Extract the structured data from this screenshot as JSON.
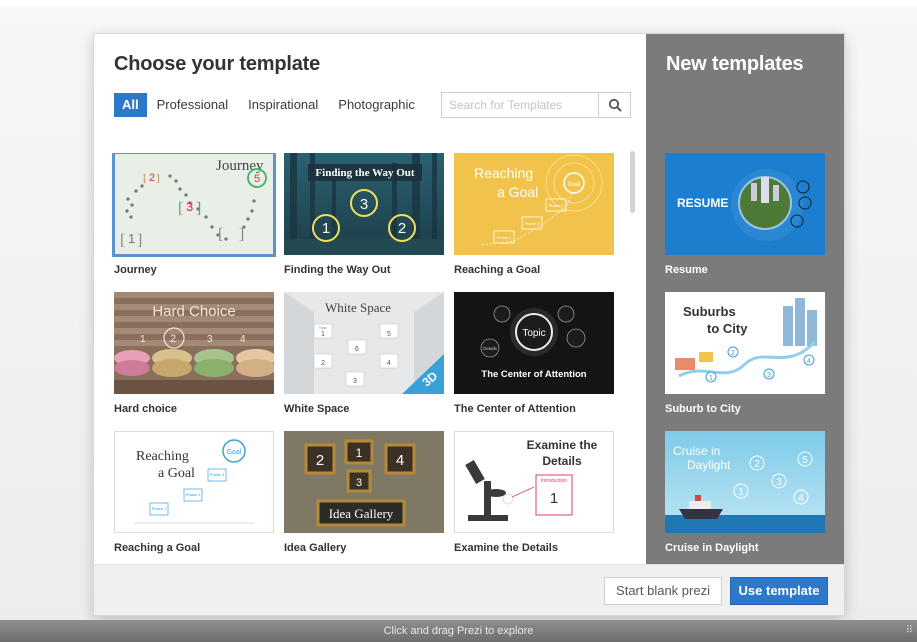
{
  "dialog": {
    "title": "Choose your template",
    "side_title": "New templates"
  },
  "filters": [
    {
      "label": "All",
      "active": true
    },
    {
      "label": "Professional",
      "active": false
    },
    {
      "label": "Inspirational",
      "active": false
    },
    {
      "label": "Photographic",
      "active": false
    }
  ],
  "search": {
    "placeholder": "Search for Templates",
    "value": "",
    "icon": "search-icon"
  },
  "templates": [
    {
      "label": "Journey",
      "selected": true,
      "thumb_text": [
        "Journey",
        "2",
        "3",
        "1",
        "5"
      ]
    },
    {
      "label": "Finding the Way Out",
      "selected": false,
      "thumb_text": [
        "Finding the Way Out",
        "1",
        "3",
        "2"
      ]
    },
    {
      "label": "Reaching a Goal",
      "selected": false,
      "thumb_text": [
        "Reaching",
        "a Goal",
        "Goal",
        "Phase 1",
        "Phase 2",
        "Phase 3"
      ]
    },
    {
      "label": "Hard choice",
      "selected": false,
      "thumb_text": [
        "Hard Choice",
        "1",
        "2",
        "3",
        "4"
      ]
    },
    {
      "label": "White Space",
      "selected": false,
      "thumb_text": [
        "White Space",
        "Topic",
        "1",
        "5",
        "6",
        "2",
        "4",
        "3",
        "3D"
      ]
    },
    {
      "label": "The Center of Attention",
      "selected": false,
      "thumb_text": [
        "Topic",
        "Details",
        "The Center of Attention"
      ]
    },
    {
      "label": "Reaching a Goal",
      "selected": false,
      "thumb_text": [
        "Reaching",
        "a Goal",
        "Goal",
        "Phase 1",
        "Phase 2",
        "Phase 3"
      ]
    },
    {
      "label": "Idea Gallery",
      "selected": false,
      "thumb_text": [
        "2",
        "1",
        "4",
        "3",
        "Idea Gallery"
      ]
    },
    {
      "label": "Examine the Details",
      "selected": false,
      "thumb_text": [
        "Examine the",
        "Details",
        "Introduction",
        "1"
      ]
    }
  ],
  "new_templates": [
    {
      "label": "Resume",
      "thumb_text": [
        "RESUME"
      ]
    },
    {
      "label": "Suburb to City",
      "thumb_text": [
        "Suburbs",
        "to City",
        "1",
        "2",
        "3",
        "4"
      ]
    },
    {
      "label": "Cruise in Daylight",
      "thumb_text": [
        "Cruise in",
        "Daylight",
        "1",
        "2",
        "3",
        "4",
        "5"
      ]
    }
  ],
  "footer": {
    "start_blank_label": "Start blank prezi",
    "use_template_label": "Use template"
  },
  "status_bar": {
    "hint": "Click and drag Prezi to explore"
  },
  "colors": {
    "accent": "#2d78c8",
    "side_panel": "#7b7b7b",
    "selected_outline": "#5b93cf"
  }
}
